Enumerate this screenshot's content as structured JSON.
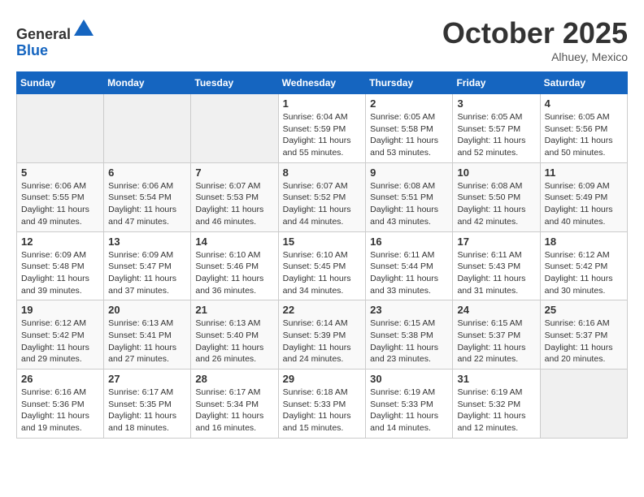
{
  "header": {
    "logo_general": "General",
    "logo_blue": "Blue",
    "month": "October 2025",
    "location": "Alhuey, Mexico"
  },
  "weekdays": [
    "Sunday",
    "Monday",
    "Tuesday",
    "Wednesday",
    "Thursday",
    "Friday",
    "Saturday"
  ],
  "weeks": [
    [
      {
        "day": "",
        "empty": true
      },
      {
        "day": "",
        "empty": true
      },
      {
        "day": "",
        "empty": true
      },
      {
        "day": "1",
        "sunrise": "Sunrise: 6:04 AM",
        "sunset": "Sunset: 5:59 PM",
        "daylight": "Daylight: 11 hours and 55 minutes."
      },
      {
        "day": "2",
        "sunrise": "Sunrise: 6:05 AM",
        "sunset": "Sunset: 5:58 PM",
        "daylight": "Daylight: 11 hours and 53 minutes."
      },
      {
        "day": "3",
        "sunrise": "Sunrise: 6:05 AM",
        "sunset": "Sunset: 5:57 PM",
        "daylight": "Daylight: 11 hours and 52 minutes."
      },
      {
        "day": "4",
        "sunrise": "Sunrise: 6:05 AM",
        "sunset": "Sunset: 5:56 PM",
        "daylight": "Daylight: 11 hours and 50 minutes."
      }
    ],
    [
      {
        "day": "5",
        "sunrise": "Sunrise: 6:06 AM",
        "sunset": "Sunset: 5:55 PM",
        "daylight": "Daylight: 11 hours and 49 minutes."
      },
      {
        "day": "6",
        "sunrise": "Sunrise: 6:06 AM",
        "sunset": "Sunset: 5:54 PM",
        "daylight": "Daylight: 11 hours and 47 minutes."
      },
      {
        "day": "7",
        "sunrise": "Sunrise: 6:07 AM",
        "sunset": "Sunset: 5:53 PM",
        "daylight": "Daylight: 11 hours and 46 minutes."
      },
      {
        "day": "8",
        "sunrise": "Sunrise: 6:07 AM",
        "sunset": "Sunset: 5:52 PM",
        "daylight": "Daylight: 11 hours and 44 minutes."
      },
      {
        "day": "9",
        "sunrise": "Sunrise: 6:08 AM",
        "sunset": "Sunset: 5:51 PM",
        "daylight": "Daylight: 11 hours and 43 minutes."
      },
      {
        "day": "10",
        "sunrise": "Sunrise: 6:08 AM",
        "sunset": "Sunset: 5:50 PM",
        "daylight": "Daylight: 11 hours and 42 minutes."
      },
      {
        "day": "11",
        "sunrise": "Sunrise: 6:09 AM",
        "sunset": "Sunset: 5:49 PM",
        "daylight": "Daylight: 11 hours and 40 minutes."
      }
    ],
    [
      {
        "day": "12",
        "sunrise": "Sunrise: 6:09 AM",
        "sunset": "Sunset: 5:48 PM",
        "daylight": "Daylight: 11 hours and 39 minutes."
      },
      {
        "day": "13",
        "sunrise": "Sunrise: 6:09 AM",
        "sunset": "Sunset: 5:47 PM",
        "daylight": "Daylight: 11 hours and 37 minutes."
      },
      {
        "day": "14",
        "sunrise": "Sunrise: 6:10 AM",
        "sunset": "Sunset: 5:46 PM",
        "daylight": "Daylight: 11 hours and 36 minutes."
      },
      {
        "day": "15",
        "sunrise": "Sunrise: 6:10 AM",
        "sunset": "Sunset: 5:45 PM",
        "daylight": "Daylight: 11 hours and 34 minutes."
      },
      {
        "day": "16",
        "sunrise": "Sunrise: 6:11 AM",
        "sunset": "Sunset: 5:44 PM",
        "daylight": "Daylight: 11 hours and 33 minutes."
      },
      {
        "day": "17",
        "sunrise": "Sunrise: 6:11 AM",
        "sunset": "Sunset: 5:43 PM",
        "daylight": "Daylight: 11 hours and 31 minutes."
      },
      {
        "day": "18",
        "sunrise": "Sunrise: 6:12 AM",
        "sunset": "Sunset: 5:42 PM",
        "daylight": "Daylight: 11 hours and 30 minutes."
      }
    ],
    [
      {
        "day": "19",
        "sunrise": "Sunrise: 6:12 AM",
        "sunset": "Sunset: 5:42 PM",
        "daylight": "Daylight: 11 hours and 29 minutes."
      },
      {
        "day": "20",
        "sunrise": "Sunrise: 6:13 AM",
        "sunset": "Sunset: 5:41 PM",
        "daylight": "Daylight: 11 hours and 27 minutes."
      },
      {
        "day": "21",
        "sunrise": "Sunrise: 6:13 AM",
        "sunset": "Sunset: 5:40 PM",
        "daylight": "Daylight: 11 hours and 26 minutes."
      },
      {
        "day": "22",
        "sunrise": "Sunrise: 6:14 AM",
        "sunset": "Sunset: 5:39 PM",
        "daylight": "Daylight: 11 hours and 24 minutes."
      },
      {
        "day": "23",
        "sunrise": "Sunrise: 6:15 AM",
        "sunset": "Sunset: 5:38 PM",
        "daylight": "Daylight: 11 hours and 23 minutes."
      },
      {
        "day": "24",
        "sunrise": "Sunrise: 6:15 AM",
        "sunset": "Sunset: 5:37 PM",
        "daylight": "Daylight: 11 hours and 22 minutes."
      },
      {
        "day": "25",
        "sunrise": "Sunrise: 6:16 AM",
        "sunset": "Sunset: 5:37 PM",
        "daylight": "Daylight: 11 hours and 20 minutes."
      }
    ],
    [
      {
        "day": "26",
        "sunrise": "Sunrise: 6:16 AM",
        "sunset": "Sunset: 5:36 PM",
        "daylight": "Daylight: 11 hours and 19 minutes."
      },
      {
        "day": "27",
        "sunrise": "Sunrise: 6:17 AM",
        "sunset": "Sunset: 5:35 PM",
        "daylight": "Daylight: 11 hours and 18 minutes."
      },
      {
        "day": "28",
        "sunrise": "Sunrise: 6:17 AM",
        "sunset": "Sunset: 5:34 PM",
        "daylight": "Daylight: 11 hours and 16 minutes."
      },
      {
        "day": "29",
        "sunrise": "Sunrise: 6:18 AM",
        "sunset": "Sunset: 5:33 PM",
        "daylight": "Daylight: 11 hours and 15 minutes."
      },
      {
        "day": "30",
        "sunrise": "Sunrise: 6:19 AM",
        "sunset": "Sunset: 5:33 PM",
        "daylight": "Daylight: 11 hours and 14 minutes."
      },
      {
        "day": "31",
        "sunrise": "Sunrise: 6:19 AM",
        "sunset": "Sunset: 5:32 PM",
        "daylight": "Daylight: 11 hours and 12 minutes."
      },
      {
        "day": "",
        "empty": true
      }
    ]
  ]
}
